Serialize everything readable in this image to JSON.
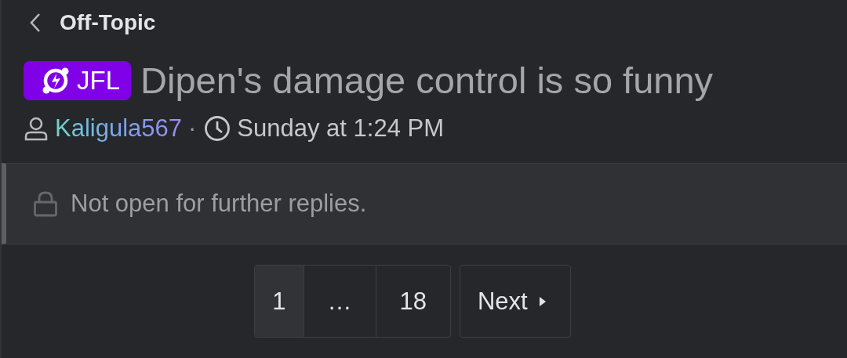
{
  "breadcrumb": {
    "label": "Off-Topic"
  },
  "thread": {
    "prefix": {
      "label": "JFL",
      "color": "#8000e8"
    },
    "title": "Dipen's damage control is so funny",
    "author": "Kaligula567",
    "separator": "·",
    "time": "Sunday at 1:24 PM"
  },
  "notice": {
    "text": "Not open for further replies."
  },
  "pagination": {
    "pages": [
      {
        "label": "1",
        "selected": true
      },
      {
        "label": "…",
        "selected": false
      },
      {
        "label": "18",
        "selected": false
      }
    ],
    "next": {
      "label": "Next"
    }
  }
}
